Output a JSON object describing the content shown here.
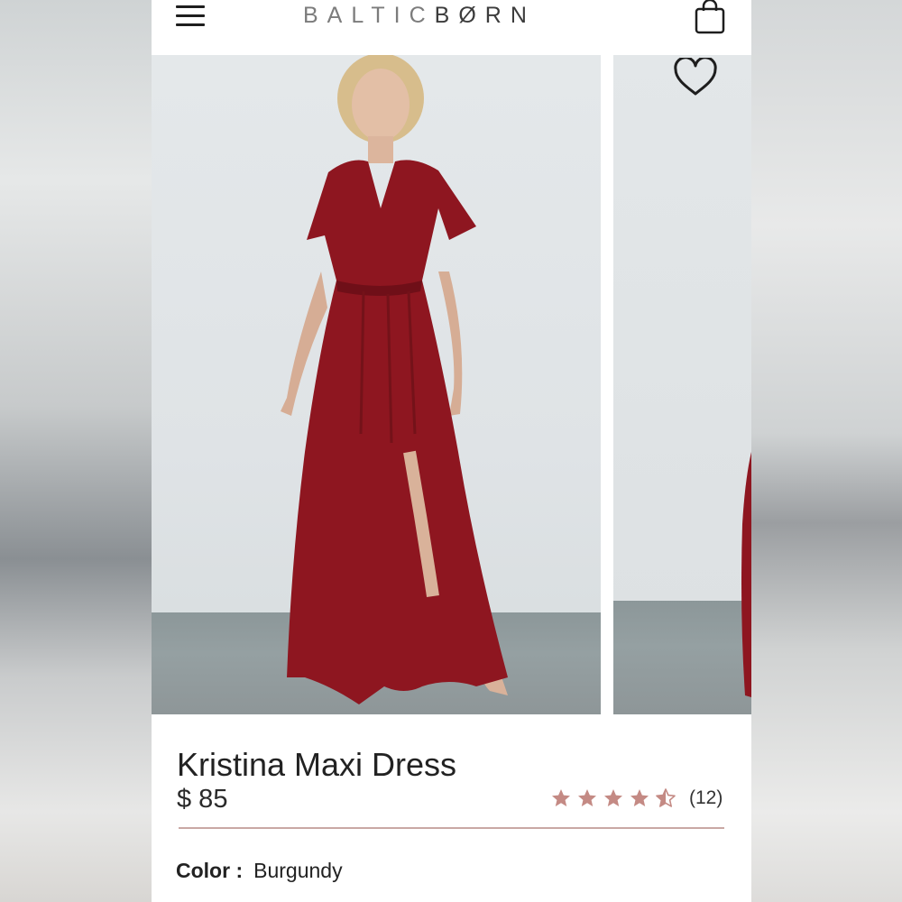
{
  "header": {
    "menu_icon": "hamburger-menu-icon",
    "brand_part1": "BALTIC",
    "brand_part2": "BØRN",
    "cart_icon": "shopping-bag-icon"
  },
  "gallery": {
    "wishlist_icon": "heart-outline-icon",
    "main_image_alt": "Model wearing burgundy maxi dress",
    "next_image_alt": "Next product image"
  },
  "product": {
    "name": "Kristina Maxi Dress",
    "price": "$ 85",
    "rating": 4.5,
    "rating_count": "(12)",
    "color_label": "Color :",
    "color_value": "Burgundy"
  },
  "colors": {
    "star": "#c48a84",
    "divider": "#c9a8a4",
    "dress": "#8e1620"
  }
}
